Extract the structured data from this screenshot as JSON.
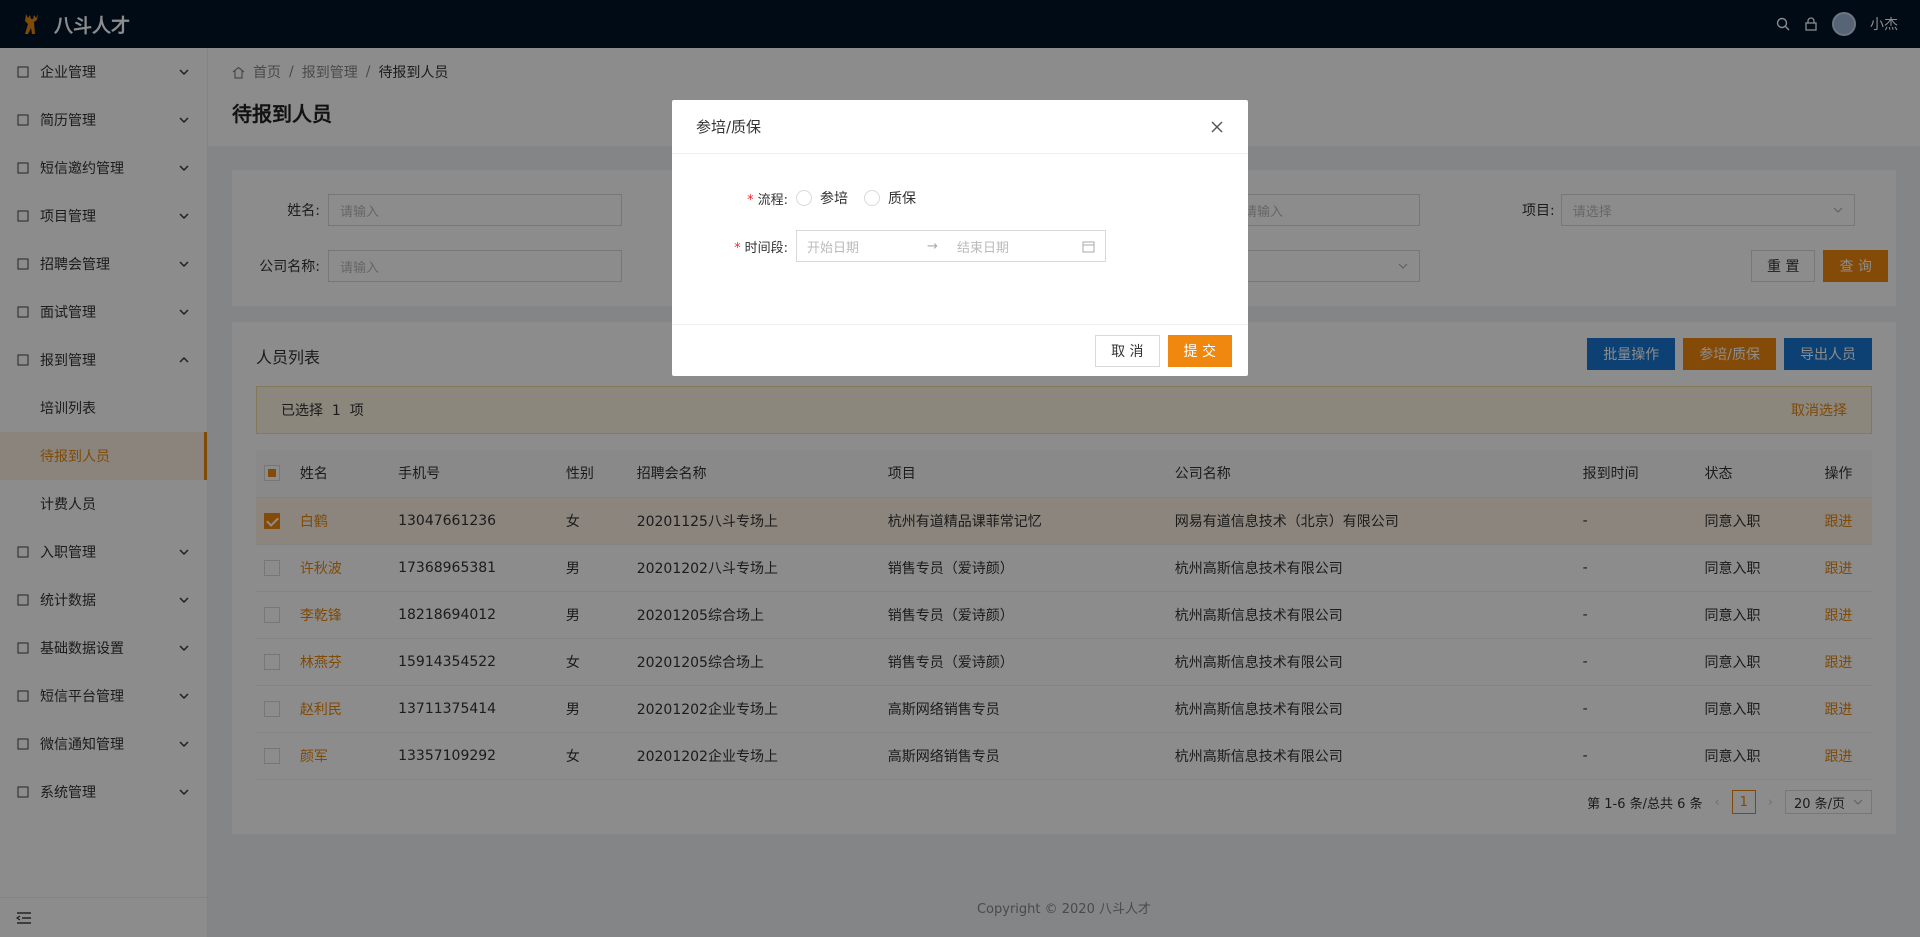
{
  "app": {
    "brand": "八斗人才",
    "user_name": "小杰"
  },
  "sidebar": {
    "items": [
      {
        "label": "企业管理",
        "icon": "building-icon"
      },
      {
        "label": "简历管理",
        "icon": "document-icon"
      },
      {
        "label": "短信邀约管理",
        "icon": "mail-icon"
      },
      {
        "label": "项目管理",
        "icon": "project-icon"
      },
      {
        "label": "招聘会管理",
        "icon": "fair-icon"
      },
      {
        "label": "面试管理",
        "icon": "interview-icon"
      },
      {
        "label": "报到管理",
        "icon": "checkin-icon",
        "expanded": true,
        "children": [
          {
            "label": "培训列表"
          },
          {
            "label": "待报到人员",
            "active": true
          },
          {
            "label": "计费人员"
          }
        ]
      },
      {
        "label": "入职管理",
        "icon": "user-icon"
      },
      {
        "label": "统计数据",
        "icon": "chart-icon"
      },
      {
        "label": "基础数据设置",
        "icon": "folder-icon"
      },
      {
        "label": "短信平台管理",
        "icon": "mail-icon"
      },
      {
        "label": "微信通知管理",
        "icon": "mail-icon"
      },
      {
        "label": "系统管理",
        "icon": "gear-icon"
      }
    ]
  },
  "breadcrumb": {
    "home": "首页",
    "parent": "报到管理",
    "current": "待报到人员"
  },
  "page_title": "待报到人员",
  "search": {
    "name_label": "姓名:",
    "name_placeholder": "请输入",
    "company_label": "公司名称:",
    "company_placeholder": "请输入",
    "project_label": "项目:",
    "project_placeholder": "请选择",
    "hidden_placeholder": "请输入",
    "reset": "重 置",
    "query": "查 询"
  },
  "list": {
    "title": "人员列表",
    "actions": {
      "batch": "批量操作",
      "train": "参培/质保",
      "export": "导出人员"
    },
    "selected_prefix": "已选择",
    "selected_count": "1",
    "selected_suffix": "项",
    "cancel_selection": "取消选择",
    "columns": [
      "姓名",
      "手机号",
      "性别",
      "招聘会名称",
      "项目",
      "公司名称",
      "报到时间",
      "状态",
      "操作"
    ],
    "rows": [
      {
        "name": "白鹤",
        "phone": "13047661236",
        "gender": "女",
        "fair": "20201125八斗专场上",
        "project": "杭州有道精品课菲常记忆",
        "company": "网易有道信息技术（北京）有限公司",
        "time": "-",
        "status": "同意入职",
        "op": "跟进",
        "selected": true
      },
      {
        "name": "许秋波",
        "phone": "17368965381",
        "gender": "男",
        "fair": "20201202八斗专场上",
        "project": "销售专员（爱诗颜）",
        "company": "杭州高斯信息技术有限公司",
        "time": "-",
        "status": "同意入职",
        "op": "跟进"
      },
      {
        "name": "李乾锋",
        "phone": "18218694012",
        "gender": "男",
        "fair": "20201205综合场上",
        "project": "销售专员（爱诗颜）",
        "company": "杭州高斯信息技术有限公司",
        "time": "-",
        "status": "同意入职",
        "op": "跟进"
      },
      {
        "name": "林燕芬",
        "phone": "15914354522",
        "gender": "女",
        "fair": "20201205综合场上",
        "project": "销售专员（爱诗颜）",
        "company": "杭州高斯信息技术有限公司",
        "time": "-",
        "status": "同意入职",
        "op": "跟进"
      },
      {
        "name": "赵利民",
        "phone": "13711375414",
        "gender": "男",
        "fair": "20201202企业专场上",
        "project": "高斯网络销售专员",
        "company": "杭州高斯信息技术有限公司",
        "time": "-",
        "status": "同意入职",
        "op": "跟进"
      },
      {
        "name": "颜军",
        "phone": "13357109292",
        "gender": "女",
        "fair": "20201202企业专场上",
        "project": "高斯网络销售专员",
        "company": "杭州高斯信息技术有限公司",
        "time": "-",
        "status": "同意入职",
        "op": "跟进"
      }
    ],
    "pagination": {
      "summary": "第 1-6 条/总共 6 条",
      "current": "1",
      "page_size": "20 条/页"
    }
  },
  "footer": "Copyright © 2020 八斗人才",
  "modal": {
    "title": "参培/质保",
    "flow_label": "流程:",
    "flow_options": [
      "参培",
      "质保"
    ],
    "period_label": "时间段:",
    "start_placeholder": "开始日期",
    "end_placeholder": "结束日期",
    "cancel": "取 消",
    "submit": "提 交"
  },
  "colors": {
    "accent": "#f0870e",
    "primary_blue": "#1976d2",
    "topbar": "#001529"
  }
}
